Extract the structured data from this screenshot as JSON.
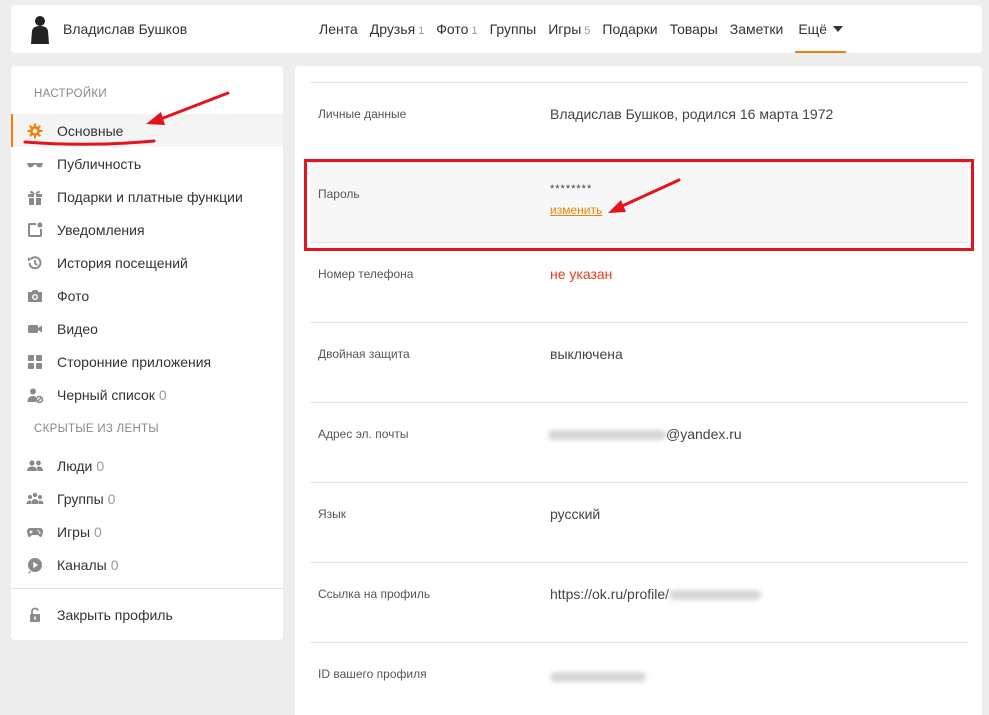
{
  "header": {
    "user_name": "Владислав Бушков",
    "nav": [
      {
        "label": "Лента",
        "count": ""
      },
      {
        "label": "Друзья",
        "count": "1"
      },
      {
        "label": "Фото",
        "count": "1"
      },
      {
        "label": "Группы",
        "count": ""
      },
      {
        "label": "Игры",
        "count": "5"
      },
      {
        "label": "Подарки",
        "count": ""
      },
      {
        "label": "Товары",
        "count": ""
      },
      {
        "label": "Заметки",
        "count": ""
      }
    ],
    "more_label": "Ещё"
  },
  "sidebar": {
    "settings_title": "НАСТРОЙКИ",
    "items": [
      {
        "label": "Основные",
        "icon": "gear-icon",
        "active": true
      },
      {
        "label": "Публичность",
        "icon": "glasses-icon"
      },
      {
        "label": "Подарки и платные функции",
        "icon": "gift-icon"
      },
      {
        "label": "Уведомления",
        "icon": "notification-icon"
      },
      {
        "label": "История посещений",
        "icon": "history-icon"
      },
      {
        "label": "Фото",
        "icon": "camera-icon"
      },
      {
        "label": "Видео",
        "icon": "video-icon"
      },
      {
        "label": "Сторонние приложения",
        "icon": "apps-icon"
      },
      {
        "label": "Черный список",
        "count": "0",
        "icon": "blacklist-icon"
      }
    ],
    "hidden_title": "СКРЫТЫЕ ИЗ ЛЕНТЫ",
    "hidden_items": [
      {
        "label": "Люди",
        "count": "0",
        "icon": "people-icon"
      },
      {
        "label": "Группы",
        "count": "0",
        "icon": "groups-icon"
      },
      {
        "label": "Игры",
        "count": "0",
        "icon": "gamepad-icon"
      },
      {
        "label": "Каналы",
        "count": "0",
        "icon": "channel-icon"
      }
    ],
    "close_profile_label": "Закрыть профиль"
  },
  "settings": {
    "personal": {
      "label": "Личные данные",
      "value": "Владислав Бушков, родился 16 марта 1972"
    },
    "password": {
      "label": "Пароль",
      "value": "********",
      "change_label": "изменить"
    },
    "phone": {
      "label": "Номер телефона",
      "value": "не указан"
    },
    "twofactor": {
      "label": "Двойная защита",
      "value": "выключена"
    },
    "email": {
      "label": "Адрес эл. почты",
      "value_suffix": "@yandex.ru"
    },
    "language": {
      "label": "Язык",
      "value": "русский"
    },
    "profile_link": {
      "label": "Ссылка на профиль",
      "value_prefix": "https://ok.ru/profile/"
    },
    "profile_id": {
      "label": "ID вашего профиля"
    }
  },
  "colors": {
    "accent": "#ee8208",
    "annotation_red": "#e3141d",
    "warning_text": "#e33d1b"
  }
}
